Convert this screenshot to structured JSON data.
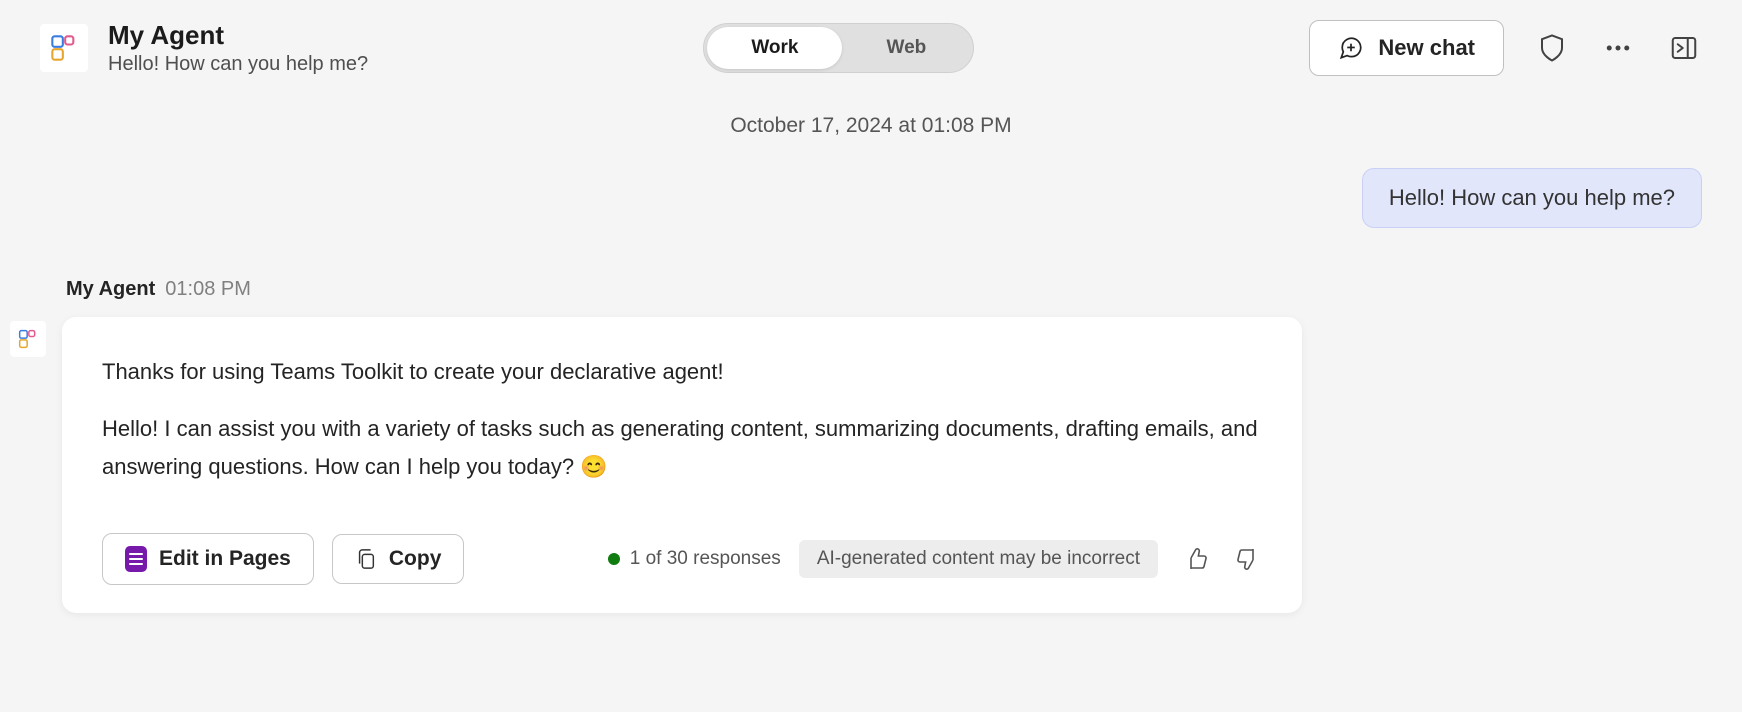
{
  "header": {
    "agent_name": "My Agent",
    "agent_subtitle": "Hello! How can you help me?",
    "scope_toggle": {
      "work_label": "Work",
      "web_label": "Web",
      "active": "work"
    },
    "new_chat_label": "New chat"
  },
  "conversation": {
    "timestamp": "October 17, 2024 at 01:08 PM",
    "user_message": "Hello! How can you help me?",
    "agent_reply": {
      "sender": "My Agent",
      "time": "01:08 PM",
      "paragraph1": "Thanks for using Teams Toolkit to create your declarative agent!",
      "paragraph2": "Hello! I can assist you with a variety of tasks such as generating content, summarizing documents, drafting emails, and answering questions. How can I help you today?  😊"
    }
  },
  "footer": {
    "edit_in_pages_label": "Edit in Pages",
    "copy_label": "Copy",
    "response_counter": "1 of 30 responses",
    "disclaimer": "AI-generated content may be incorrect"
  }
}
